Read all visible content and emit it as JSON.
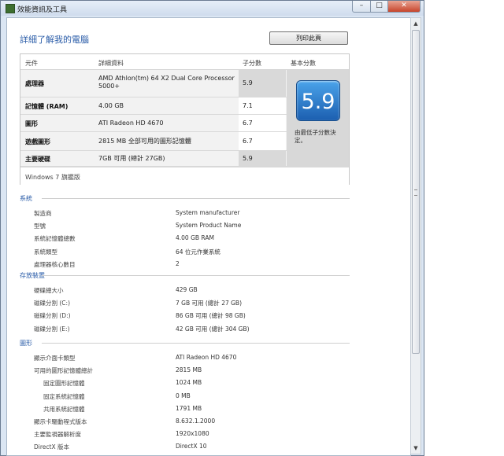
{
  "window": {
    "title": "效能資訊及工具",
    "min_glyph": "–",
    "max_glyph": "□",
    "close_glyph": "✕"
  },
  "page": {
    "title": "詳細了解我的電腦",
    "print_button": "列印此頁"
  },
  "score_table": {
    "headers": [
      "元件",
      "詳細資料",
      "子分數",
      "基本分數"
    ],
    "rows": [
      {
        "component": "處理器",
        "details": "AMD Athlon(tm) 64 X2 Dual Core Processor 5000+",
        "subscore": "5.9"
      },
      {
        "component": "記憶體 (RAM)",
        "details": "4.00 GB",
        "subscore": "7.1"
      },
      {
        "component": "圖形",
        "details": "ATI Radeon HD 4670",
        "subscore": "6.7"
      },
      {
        "component": "遊戲圖形",
        "details": "2815 MB 全部可用的圖形記憶體",
        "subscore": "6.7"
      },
      {
        "component": "主要硬碟",
        "details": "7GB 可用 (總計 27GB)",
        "subscore": "5.9"
      }
    ],
    "base_score": "5.9",
    "base_note": "由最低子分數決定。",
    "edition": "Windows 7 旗艦版"
  },
  "sections": [
    {
      "title": "系統",
      "items": [
        {
          "label": "製造商",
          "value": "System manufacturer",
          "indent": 0
        },
        {
          "label": "型號",
          "value": "System Product Name",
          "indent": 0
        },
        {
          "label": "系統記憶體總數",
          "value": "4.00 GB RAM",
          "indent": 0
        },
        {
          "label": "系統類型",
          "value": "64 位元作業系統",
          "indent": 0
        },
        {
          "label": "處理器核心數目",
          "value": "2",
          "indent": 0
        }
      ]
    },
    {
      "title": "存放裝置",
      "items": [
        {
          "label": "硬碟總大小",
          "value": "429 GB",
          "indent": 0
        },
        {
          "label": "磁碟分割 (C:)",
          "value": "7 GB 可用 (總計 27 GB)",
          "indent": 0
        },
        {
          "label": "磁碟分割 (D:)",
          "value": "86 GB 可用 (總計 98 GB)",
          "indent": 0
        },
        {
          "label": "磁碟分割 (E:)",
          "value": "42 GB 可用 (總計 304 GB)",
          "indent": 0
        }
      ]
    },
    {
      "title": "圖形",
      "items": [
        {
          "label": "顯示介面卡類型",
          "value": "ATI Radeon HD 4670",
          "indent": 0
        },
        {
          "label": "可用的圖形記憶體總計",
          "value": "2815 MB",
          "indent": 0
        },
        {
          "label": "固定圖形記憶體",
          "value": "1024 MB",
          "indent": 1
        },
        {
          "label": "固定系統記憶體",
          "value": "0 MB",
          "indent": 1
        },
        {
          "label": "共用系統記憶體",
          "value": "1791 MB",
          "indent": 1
        },
        {
          "label": "顯示卡驅動程式版本",
          "value": "8.632.1.2000",
          "indent": 0
        },
        {
          "label": "主要監視器解析度",
          "value": "1920x1080",
          "indent": 0
        },
        {
          "label": "DirectX 版本",
          "value": "DirectX 10",
          "indent": 0
        }
      ]
    }
  ]
}
